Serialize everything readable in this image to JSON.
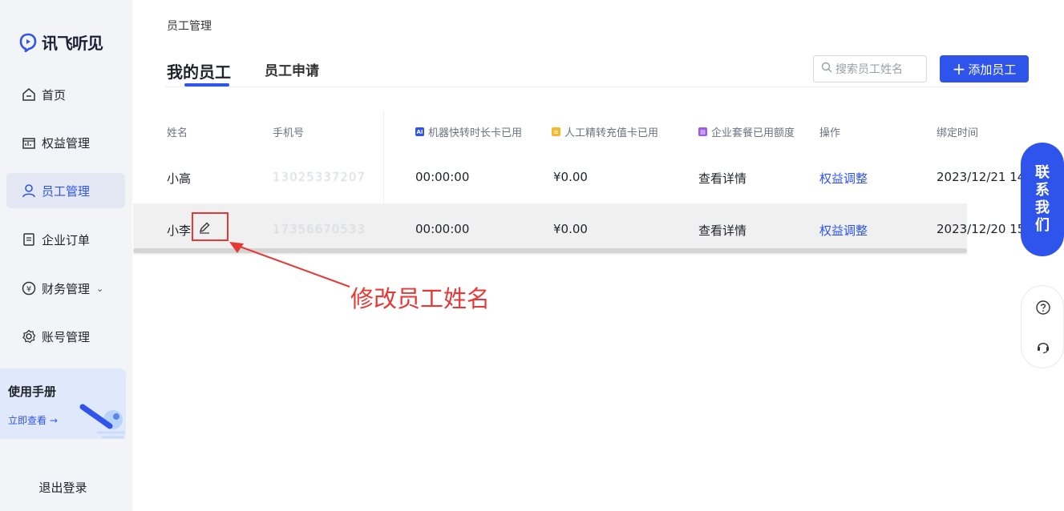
{
  "brand": {
    "name": "讯飞听见"
  },
  "sidebar": {
    "items": [
      {
        "label": "首页",
        "icon": "home-icon"
      },
      {
        "label": "权益管理",
        "icon": "gift-icon"
      },
      {
        "label": "员工管理",
        "icon": "user-icon",
        "active": true
      },
      {
        "label": "企业订单",
        "icon": "order-icon"
      },
      {
        "label": "财务管理",
        "icon": "finance-icon",
        "caret": "⌄"
      },
      {
        "label": "账号管理",
        "icon": "gear-icon"
      }
    ],
    "manual": {
      "title": "使用手册",
      "link": "立即查看 →"
    },
    "logout": "退出登录"
  },
  "breadcrumb": "员工管理",
  "tabs": [
    {
      "label": "我的员工",
      "active": true
    },
    {
      "label": "员工申请",
      "active": false
    }
  ],
  "search": {
    "placeholder": "搜索员工姓名"
  },
  "add_button": {
    "plus": "+",
    "label": "添加员工"
  },
  "table": {
    "columns": [
      {
        "label": "姓名"
      },
      {
        "label": "手机号"
      },
      {
        "label": "机器快转时长卡已用",
        "tag": "AI",
        "tag_color": "#2f54eb"
      },
      {
        "label": "人工精转充值卡已用",
        "tag": "≡",
        "tag_color": "#f5b82e"
      },
      {
        "label": "企业套餐已用额度",
        "tag": "▤",
        "tag_color": "#9b5de5"
      },
      {
        "label": "操作"
      },
      {
        "label": "绑定时间"
      }
    ],
    "rows": [
      {
        "name": "小高",
        "phone": "13025337207",
        "machine_used": "00:00:00",
        "manual_used": "¥0.00",
        "package_action": "查看详情",
        "operation": "权益调整",
        "bind_time": "2023/12/21 14"
      },
      {
        "name": "小李",
        "phone": "17356670533",
        "machine_used": "00:00:00",
        "manual_used": "¥0.00",
        "package_action": "查看详情",
        "operation": "权益调整",
        "bind_time": "2023/12/20 15"
      }
    ]
  },
  "annotation": "修改员工姓名",
  "float": {
    "contact": [
      "联",
      "系",
      "我",
      "们"
    ]
  },
  "colors": {
    "accent": "#2f54eb",
    "annotation": "#e53935"
  }
}
